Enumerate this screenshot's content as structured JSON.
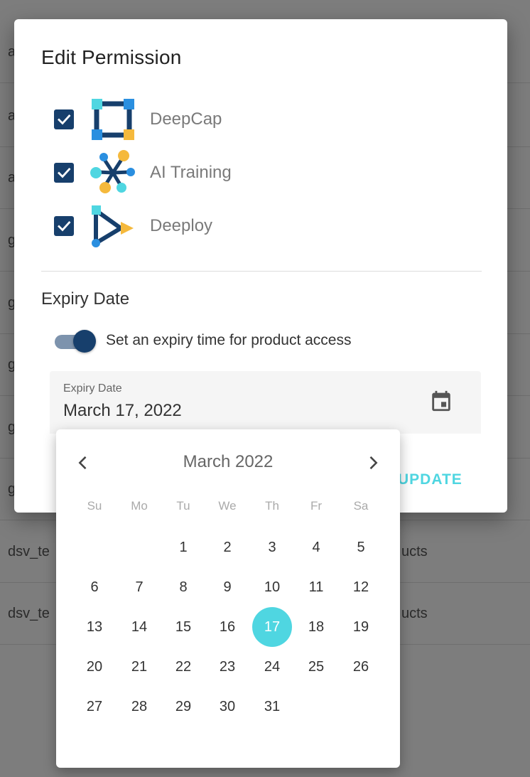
{
  "background": {
    "rows": [
      {
        "col1": "a",
        "col2": ""
      },
      {
        "col1": "a",
        "col2": ""
      },
      {
        "col1": "a",
        "col2": ""
      },
      {
        "col1": "g",
        "col2": ""
      },
      {
        "col1": "g",
        "col2": ""
      },
      {
        "col1": "g",
        "col2": ""
      },
      {
        "col1": "g",
        "col2": ""
      },
      {
        "col1": "g",
        "col2": ""
      },
      {
        "col1": "dsv_te",
        "col2": "ucts"
      },
      {
        "col1": "dsv_te",
        "col2": "ucts"
      }
    ]
  },
  "dialog": {
    "title": "Edit Permission",
    "products": [
      {
        "label": "DeepCap",
        "checked": true,
        "icon": "deepcap-logo"
      },
      {
        "label": "AI Training",
        "checked": true,
        "icon": "ai-training-logo"
      },
      {
        "label": "Deeploy",
        "checked": true,
        "icon": "deeploy-logo"
      }
    ],
    "expiry_section_title": "Expiry Date",
    "toggle_label": "Set an expiry time for product access",
    "toggle_on": true,
    "date_field": {
      "label": "Expiry Date",
      "value": "March 17, 2022",
      "icon": "calendar-icon"
    },
    "update_label": "UPDATE"
  },
  "date_picker": {
    "month_label": "March 2022",
    "prev_icon": "chevron-left-icon",
    "next_icon": "chevron-right-icon",
    "weekdays": [
      "Su",
      "Mo",
      "Tu",
      "We",
      "Th",
      "Fr",
      "Sa"
    ],
    "first_weekday_index": 2,
    "days": [
      "1",
      "2",
      "3",
      "4",
      "5",
      "6",
      "7",
      "8",
      "9",
      "10",
      "11",
      "12",
      "13",
      "14",
      "15",
      "16",
      "17",
      "18",
      "19",
      "20",
      "21",
      "22",
      "23",
      "24",
      "25",
      "26",
      "27",
      "28",
      "29",
      "30",
      "31"
    ],
    "selected_day": "17"
  },
  "colors": {
    "primary": "#173f6c",
    "accent": "#4fd6e1",
    "scrim": "#7d7d7d"
  }
}
